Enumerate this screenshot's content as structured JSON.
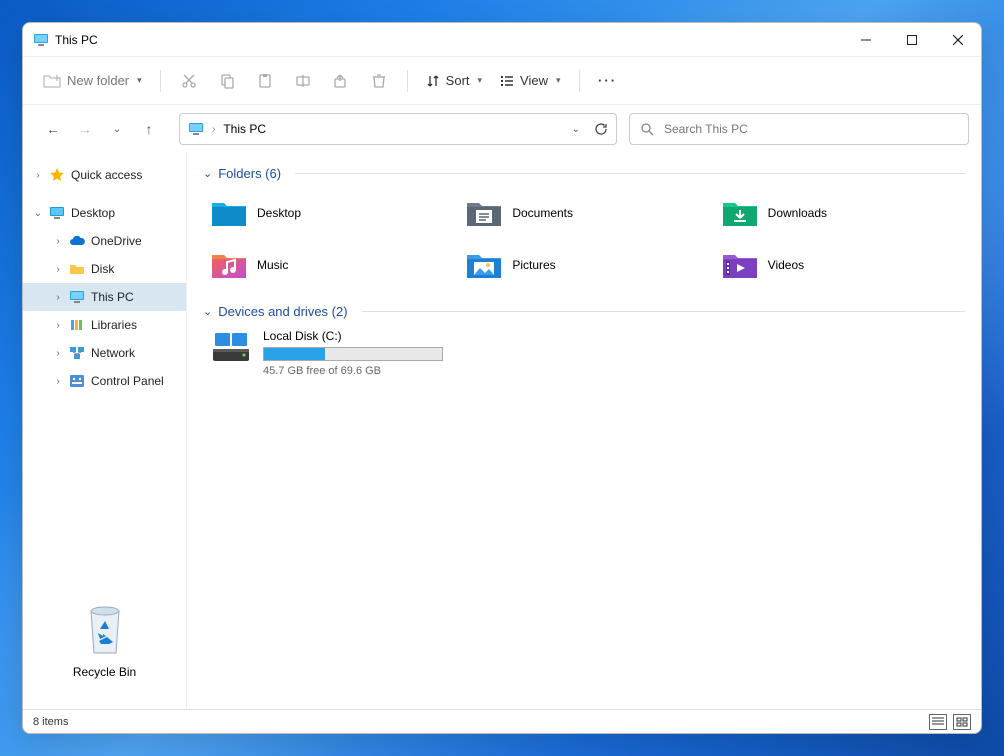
{
  "window": {
    "title": "This PC"
  },
  "toolbar": {
    "new_folder": "New folder",
    "sort": "Sort",
    "view": "View"
  },
  "address": {
    "path": "This PC"
  },
  "search": {
    "placeholder": "Search This PC"
  },
  "sidebar": {
    "quick_access": "Quick access",
    "desktop": "Desktop",
    "onedrive": "OneDrive",
    "disk": "Disk",
    "this_pc": "This PC",
    "libraries": "Libraries",
    "network": "Network",
    "control_panel": "Control Panel"
  },
  "recycle": {
    "label": "Recycle Bin"
  },
  "sections": {
    "folders": "Folders (6)",
    "drives": "Devices and drives (2)"
  },
  "folders": {
    "desktop": "Desktop",
    "documents": "Documents",
    "downloads": "Downloads",
    "music": "Music",
    "pictures": "Pictures",
    "videos": "Videos"
  },
  "drive": {
    "name": "Local Disk (C:)",
    "free": "45.7 GB free of 69.6 GB"
  },
  "status": {
    "items": "8 items"
  }
}
